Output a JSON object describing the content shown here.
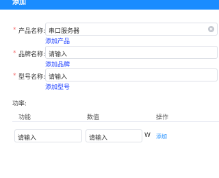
{
  "header": {
    "title": "添加"
  },
  "form": {
    "product": {
      "required_mark": "*",
      "label": "产品名称:",
      "value": "串口服务器",
      "add_link": "添加产品"
    },
    "brand": {
      "required_mark": "*",
      "label": "品牌名称:",
      "placeholder": "请输入",
      "add_link": "添加品牌"
    },
    "model": {
      "required_mark": "*",
      "label": "型号名称:",
      "placeholder": "请输入",
      "add_link": "添加型号"
    }
  },
  "power": {
    "label": "功率:",
    "columns": [
      "功能",
      "数值",
      "操作"
    ],
    "row": {
      "function_placeholder": "请输入",
      "value_placeholder": "请输入",
      "unit": "W",
      "action": "添加"
    }
  }
}
